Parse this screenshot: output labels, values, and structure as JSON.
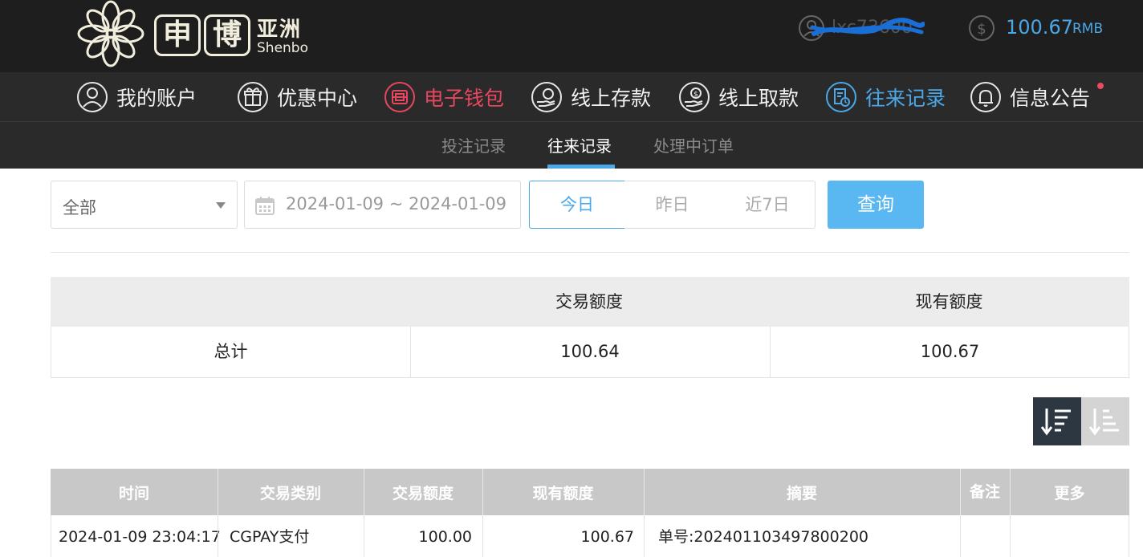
{
  "header": {
    "logo": {
      "box1": "申",
      "box2": "博",
      "cn": "亚洲",
      "en": "Shenbo"
    },
    "user": {
      "name": "lxc73600",
      "icon": "user-circle-icon"
    },
    "balance": {
      "amount": "100.67",
      "unit": "RMB",
      "icon": "dollar-coin-icon"
    }
  },
  "nav": {
    "items": [
      {
        "label": "我的账户",
        "icon": "user-circle-icon"
      },
      {
        "label": "优惠中心",
        "icon": "gift-icon"
      },
      {
        "label": "电子钱包",
        "icon": "wallet-icon"
      },
      {
        "label": "线上存款",
        "icon": "deposit-icon"
      },
      {
        "label": "线上取款",
        "icon": "withdraw-icon"
      },
      {
        "label": "往来记录",
        "icon": "records-icon"
      },
      {
        "label": "信息公告",
        "icon": "bell-icon"
      }
    ]
  },
  "subnav": {
    "tabs": [
      {
        "label": "投注记录"
      },
      {
        "label": "往来记录"
      },
      {
        "label": "处理中订单"
      }
    ]
  },
  "filter": {
    "type_select": "全部",
    "date_range": "2024-01-09 ~ 2024-01-09",
    "quick": [
      "今日",
      "昨日",
      "近7日"
    ],
    "query_label": "查询"
  },
  "summary": {
    "headers": [
      "",
      "交易额度",
      "现有额度"
    ],
    "row": [
      "总计",
      "100.64",
      "100.67"
    ]
  },
  "records": {
    "headers": [
      "时间",
      "交易类别",
      "交易额度",
      "现有额度",
      "摘要",
      "备注",
      "更多"
    ],
    "rows": [
      [
        "2024-01-09 23:04:17",
        "CGPAY支付",
        "100.00",
        "100.67",
        "单号:202401103497800200",
        "",
        ""
      ]
    ]
  },
  "colors": {
    "accent_blue": "#4aa8e8",
    "accent_red": "#e8455e",
    "query_button": "#59b7f2",
    "dark_bg": "#1e1e1e"
  }
}
